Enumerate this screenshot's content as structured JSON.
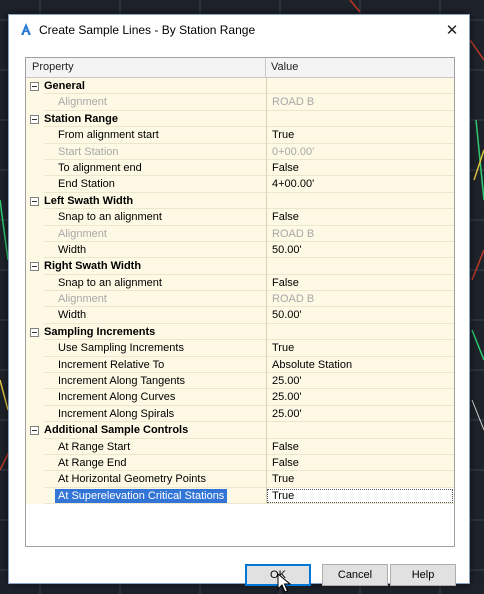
{
  "window": {
    "title": "Create Sample Lines - By Station Range",
    "app_icon": "autocad-a-icon",
    "close_glyph": "✕"
  },
  "grid": {
    "header_property": "Property",
    "header_value": "Value",
    "rows": [
      {
        "type": "category",
        "label": "General",
        "value": ""
      },
      {
        "type": "item",
        "label": "Alignment",
        "value": "ROAD B",
        "disabled": true
      },
      {
        "type": "category",
        "label": "Station Range",
        "value": ""
      },
      {
        "type": "item",
        "label": "From alignment start",
        "value": "True"
      },
      {
        "type": "item",
        "label": "Start Station",
        "value": "0+00.00'",
        "disabled": true
      },
      {
        "type": "item",
        "label": "To alignment end",
        "value": "False"
      },
      {
        "type": "item",
        "label": "End Station",
        "value": "4+00.00'"
      },
      {
        "type": "category",
        "label": "Left Swath Width",
        "value": ""
      },
      {
        "type": "item",
        "label": "Snap to an alignment",
        "value": "False"
      },
      {
        "type": "item",
        "label": "Alignment",
        "value": "ROAD B",
        "disabled": true
      },
      {
        "type": "item",
        "label": "Width",
        "value": "50.00'"
      },
      {
        "type": "category",
        "label": "Right Swath Width",
        "value": ""
      },
      {
        "type": "item",
        "label": "Snap to an alignment",
        "value": "False"
      },
      {
        "type": "item",
        "label": "Alignment",
        "value": "ROAD B",
        "disabled": true
      },
      {
        "type": "item",
        "label": "Width",
        "value": "50.00'"
      },
      {
        "type": "category",
        "label": "Sampling Increments",
        "value": ""
      },
      {
        "type": "item",
        "label": "Use Sampling Increments",
        "value": "True"
      },
      {
        "type": "item",
        "label": "Increment Relative To",
        "value": "Absolute Station"
      },
      {
        "type": "item",
        "label": "Increment Along Tangents",
        "value": "25.00'"
      },
      {
        "type": "item",
        "label": "Increment Along Curves",
        "value": "25.00'"
      },
      {
        "type": "item",
        "label": "Increment Along Spirals",
        "value": "25.00'"
      },
      {
        "type": "category",
        "label": "Additional Sample Controls",
        "value": ""
      },
      {
        "type": "item",
        "label": "At Range Start",
        "value": "False"
      },
      {
        "type": "item",
        "label": "At Range End",
        "value": "False"
      },
      {
        "type": "item",
        "label": "At Horizontal Geometry Points",
        "value": "True"
      },
      {
        "type": "item",
        "label": "At Superelevation Critical Stations",
        "value": "True",
        "selected": true
      }
    ]
  },
  "buttons": {
    "ok": "OK",
    "cancel": "Cancel",
    "help": "Help"
  },
  "colors": {
    "selection": "#3375d6",
    "row_background": "#fdf9e4",
    "background_cad": "#1e232a"
  }
}
